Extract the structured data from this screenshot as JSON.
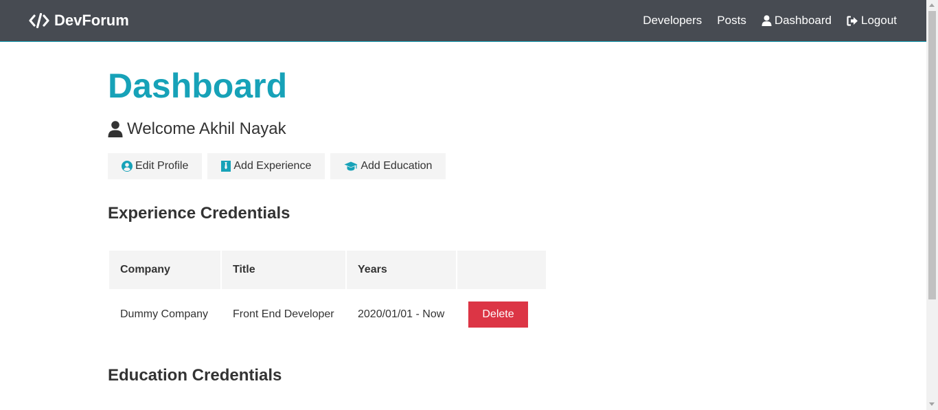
{
  "navbar": {
    "brand": "DevForum",
    "links": {
      "developers": "Developers",
      "posts": "Posts",
      "dashboard": "Dashboard",
      "logout": "Logout"
    }
  },
  "main": {
    "title": "Dashboard",
    "welcome": "Welcome Akhil Nayak",
    "actions": {
      "edit_profile": "Edit Profile",
      "add_experience": "Add Experience",
      "add_education": "Add Education"
    },
    "experience": {
      "heading": "Experience Credentials",
      "columns": [
        "Company",
        "Title",
        "Years",
        ""
      ],
      "rows": [
        {
          "company": "Dummy Company",
          "title": "Front End Developer",
          "years": "2020/01/01 - Now",
          "action": "Delete"
        }
      ]
    },
    "education": {
      "heading": "Education Credentials"
    }
  },
  "icons": {
    "brand": "code-icon",
    "dashboard": "user-icon",
    "logout": "sign-out-icon",
    "welcome": "user-icon",
    "edit_profile": "user-circle-icon",
    "add_experience": "black-tie-icon",
    "add_education": "graduation-cap-icon"
  },
  "colors": {
    "navbar": "#474b52",
    "primary": "#17a2b8",
    "danger": "#dc3545",
    "light": "#f4f4f4"
  }
}
